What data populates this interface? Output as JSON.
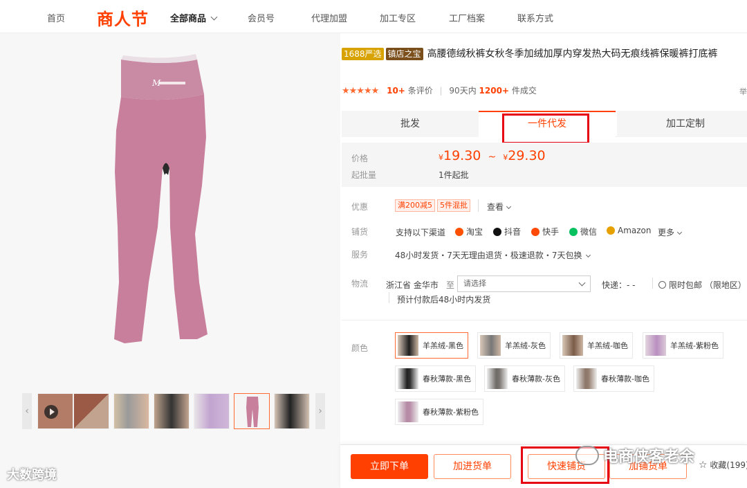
{
  "nav": {
    "home": "首页",
    "brand": "商人节",
    "all_products": "全部商品",
    "member": "会员号",
    "agent": "代理加盟",
    "processing": "加工专区",
    "factory": "工厂档案",
    "contact": "联系方式"
  },
  "product": {
    "badge_yanxuan": "1688严选",
    "badge_store": "镇店之宝",
    "title": "高腰德绒秋裤女秋冬季加绒加厚内穿发热大码无痕线裤保暖裤打底裤",
    "stars": "★★★★★",
    "review_count": "10+",
    "review_label": "条评价",
    "days_label": "90天内",
    "deal_count": "1200+",
    "deal_label": "件成交",
    "cut_text": "举"
  },
  "tabs": [
    {
      "label": "批发"
    },
    {
      "label": "一件代发"
    },
    {
      "label": "加工定制"
    }
  ],
  "pricing": {
    "price_label": "价格",
    "currency": "¥",
    "low": "19.30",
    "tilde": "~",
    "high": "29.30",
    "moq_label": "起批量",
    "moq": "1件起批"
  },
  "promo": {
    "label": "优惠",
    "coupon1": "满200减5",
    "coupon2": "5件混批",
    "view": "查看"
  },
  "distribution": {
    "label": "铺货",
    "prefix": "支持以下渠道",
    "channels": [
      {
        "name": "淘宝",
        "color": "#ff5000"
      },
      {
        "name": "抖音",
        "color": "#111111"
      },
      {
        "name": "快手",
        "color": "#ff4906"
      },
      {
        "name": "微信",
        "color": "#07c160"
      },
      {
        "name": "Amazon",
        "color": "#e6a100"
      }
    ],
    "more": "更多"
  },
  "service": {
    "label": "服务",
    "text": "48小时发货・7天无理由退货・极速退款・7天包换"
  },
  "logistics": {
    "label": "物流",
    "origin": "浙江省 金华市",
    "to": "至",
    "select_placeholder": "请选择",
    "express": "快递：- -",
    "free_ship": "限时包邮 （限地区）",
    "eta": "预计付款后48小时内发货"
  },
  "color": {
    "label": "颜色",
    "options": [
      "羊羔绒-黑色",
      "羊羔绒-灰色",
      "羊羔绒-咖色",
      "羊羔绒-紫粉色",
      "春秋薄款-黑色",
      "春秋薄款-灰色",
      "春秋薄款-咖色",
      "春秋薄款-紫粉色"
    ]
  },
  "actions": {
    "buy_now": "立即下单",
    "add_cart": "加进货单",
    "quick_list": "快速铺货",
    "add_list": "加铺货单",
    "favorite": "收藏(199)"
  },
  "watermarks": {
    "left": "大数跨境",
    "right": "电商侠客老余"
  },
  "colors": {
    "accent": "#ff4000",
    "pants_pink": "#c77f9b",
    "highlight_box": "#e60012"
  }
}
